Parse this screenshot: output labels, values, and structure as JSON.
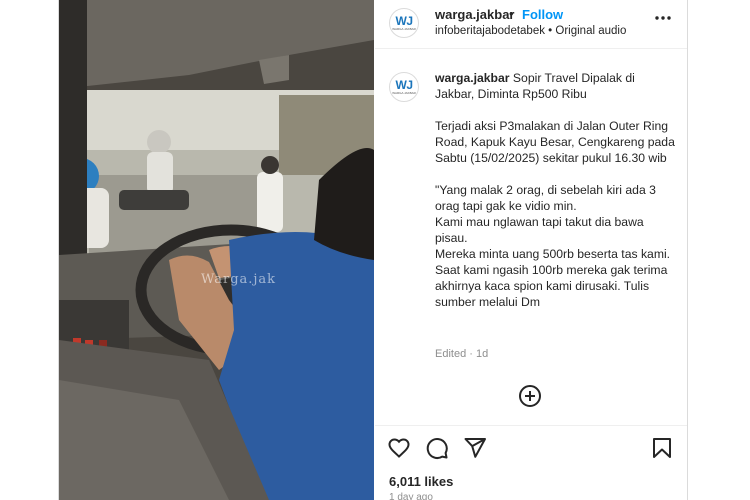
{
  "post": {
    "username": "warga.jakbar",
    "separator": "•",
    "follow_label": "Follow",
    "subtitle": "infoberitajabodetabek • Original audio",
    "avatar_initials": "WJ",
    "avatar_subtext": "WARGA JAKBAR",
    "video_watermark": "Warga.jak",
    "caption": {
      "username": "warga.jakbar",
      "lines": [
        "Sopir Travel Dipalak di Jakbar, Diminta Rp500 Ribu",
        "Terjadi aksi P3malakan di Jalan Outer Ring Road, Kapuk Kayu Besar, Cengkareng pada Sabtu (15/02/2025) sekitar pukul 16.30 wib",
        "\"Yang malak 2 orag, di sebelah kiri ada 3 orag tapi gak ke vidio min.",
        "Kami mau nglawan tapi takut dia bawa pisau.",
        "Mereka minta uang 500rb beserta tas kami. Saat kami ngasih 100rb mereka gak terima akhirnya kaca spion kami dirusaki. Tulis sumber melalui Dm"
      ]
    },
    "edited_label": "Edited · 1d",
    "likes": "6,011 likes",
    "time": "1 day ago"
  },
  "icons": {
    "more": "more-horizontal-icon",
    "add_comment": "plus-circle-icon",
    "like": "heart-icon",
    "comment": "comment-icon",
    "share": "send-icon",
    "save": "bookmark-icon"
  },
  "colors": {
    "accent": "#0095f6",
    "text": "#262626",
    "muted": "#8e8e8e",
    "border": "#dbdbdb",
    "logo_blue": "#1b75bb"
  }
}
